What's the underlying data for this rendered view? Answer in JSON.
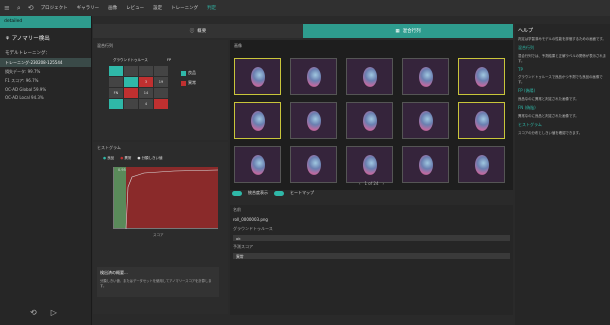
{
  "topbar": {
    "menus": [
      "プロジェクト",
      "ギャラリー",
      "画像",
      "レビュー",
      "設定",
      "トレーニング",
      "判定"
    ],
    "active_index": 6
  },
  "sidebar": {
    "header": "detailed",
    "title": "アノマリー検出",
    "model_heading": "モデルトレーニング：",
    "training_name": "トレーニング-230208-125544",
    "items": [
      "損失データ: 99.7%",
      "F1 スコア: 96.7%",
      "OC-AD Global 59.9%",
      "OC-AD Local 94.3%"
    ]
  },
  "tabs": {
    "tab1": "概要",
    "tab2": "混合行列"
  },
  "confusion": {
    "label": "混合行列",
    "gt": "グラウンドトゥルース",
    "fp": "FP",
    "legend_ok": "良品",
    "legend_ng": "異常",
    "cells": [
      "",
      "",
      "",
      "",
      "",
      "",
      3,
      19,
      "FN",
      "",
      14,
      "",
      "",
      "",
      4,
      ""
    ]
  },
  "hist": {
    "label": "ヒストグラム",
    "legend": [
      "良品",
      "異常",
      "分類しきい値"
    ],
    "xlabel": "スコア",
    "ymax": "0.95"
  },
  "gallery": {
    "label": "画像",
    "pager": "1 of 24"
  },
  "toggles": {
    "a": "統合度表示",
    "b": "ヒートマップ"
  },
  "detail": {
    "name_label": "名前",
    "name_value": "roll_0000003.png",
    "class_label": "グラウンドトゥルース",
    "class_value": "ok",
    "pred_label": "予測スコア",
    "pred_value": "異常",
    "note_title": "検出済の概要...",
    "note_text": "分類しきい値、またはデータセットを使用してアノマリースコアを計算します。"
  },
  "help": {
    "title": "ヘルプ",
    "intro": "判定は学習済みモデルの性能を評価するための画面です。",
    "sections": [
      "混合行列",
      "TP",
      "FP (偽陽)",
      "FN (偽陰)",
      "ヒストグラム"
    ],
    "desc": [
      "混合行列では、予測結果と正解ラベルの関係が表示されます。",
      "グラウンドトゥルースで良品かつ予測でも良品の画像です。",
      "良品なのに異常と判定された画像です。",
      "異常なのに良品と判定された画像です。",
      "スコアの分布としきい値を確認できます。"
    ]
  }
}
